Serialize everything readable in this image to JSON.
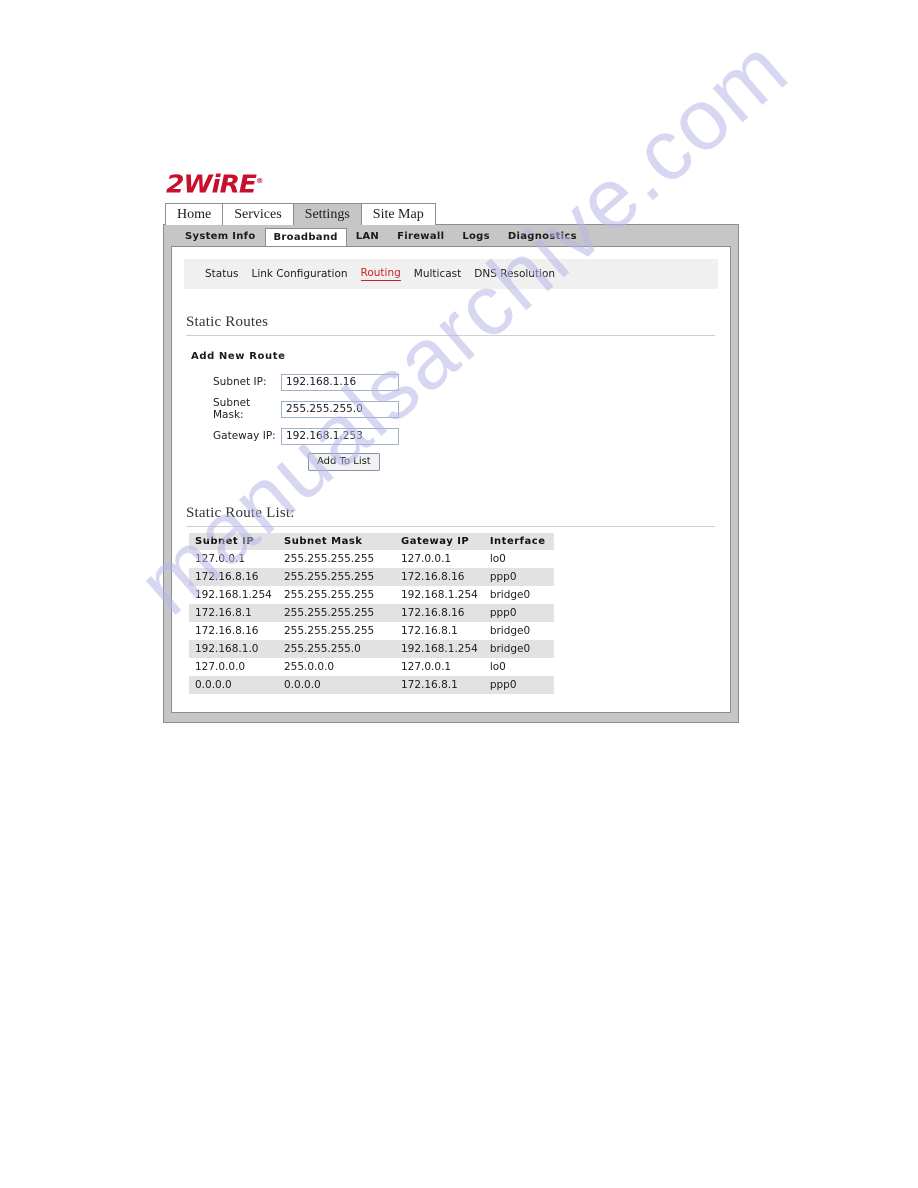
{
  "brand": {
    "logo_text": "2WiRE",
    "logo_mark": "registered-trademark",
    "logo_color": "#c8102e"
  },
  "top_nav": {
    "items": [
      {
        "label": "Home",
        "active": false
      },
      {
        "label": "Services",
        "active": false
      },
      {
        "label": "Settings",
        "active": true
      },
      {
        "label": "Site Map",
        "active": false
      }
    ]
  },
  "sub_nav": {
    "items": [
      {
        "label": "System Info",
        "active": false
      },
      {
        "label": "Broadband",
        "active": true
      },
      {
        "label": "LAN",
        "active": false
      },
      {
        "label": "Firewall",
        "active": false
      },
      {
        "label": "Logs",
        "active": false
      },
      {
        "label": "Diagnostics",
        "active": false
      }
    ]
  },
  "section_nav": {
    "items": [
      {
        "label": "Status",
        "current": false
      },
      {
        "label": "Link Configuration",
        "current": false
      },
      {
        "label": "Routing",
        "current": true
      },
      {
        "label": "Multicast",
        "current": false
      },
      {
        "label": "DNS Resolution",
        "current": false
      }
    ],
    "current_color": "#cc2222"
  },
  "static_routes": {
    "heading": "Static Routes",
    "form": {
      "subheading": "Add New Route",
      "fields": [
        {
          "label": "Subnet IP:",
          "value": "192.168.1.16"
        },
        {
          "label": "Subnet Mask:",
          "value": "255.255.255.0"
        },
        {
          "label": "Gateway IP:",
          "value": "192.168.1.253"
        }
      ],
      "submit_label": "Add To List"
    },
    "list": {
      "heading": "Static Route List:",
      "columns": [
        "Subnet IP",
        "Subnet Mask",
        "Gateway IP",
        "Interface"
      ],
      "rows": [
        [
          "127.0.0.1",
          "255.255.255.255",
          "127.0.0.1",
          "lo0"
        ],
        [
          "172.16.8.16",
          "255.255.255.255",
          "172.16.8.16",
          "ppp0"
        ],
        [
          "192.168.1.254",
          "255.255.255.255",
          "192.168.1.254",
          "bridge0"
        ],
        [
          "172.16.8.1",
          "255.255.255.255",
          "172.16.8.16",
          "ppp0"
        ],
        [
          "172.16.8.16",
          "255.255.255.255",
          "172.16.8.1",
          "bridge0"
        ],
        [
          "192.168.1.0",
          "255.255.255.0",
          "192.168.1.254",
          "bridge0"
        ],
        [
          "127.0.0.0",
          "255.0.0.0",
          "127.0.0.1",
          "lo0"
        ],
        [
          "0.0.0.0",
          "0.0.0.0",
          "172.16.8.1",
          "ppp0"
        ]
      ]
    }
  },
  "watermark": {
    "text": "manualsarchive.com",
    "color": "#b9b7e8"
  }
}
